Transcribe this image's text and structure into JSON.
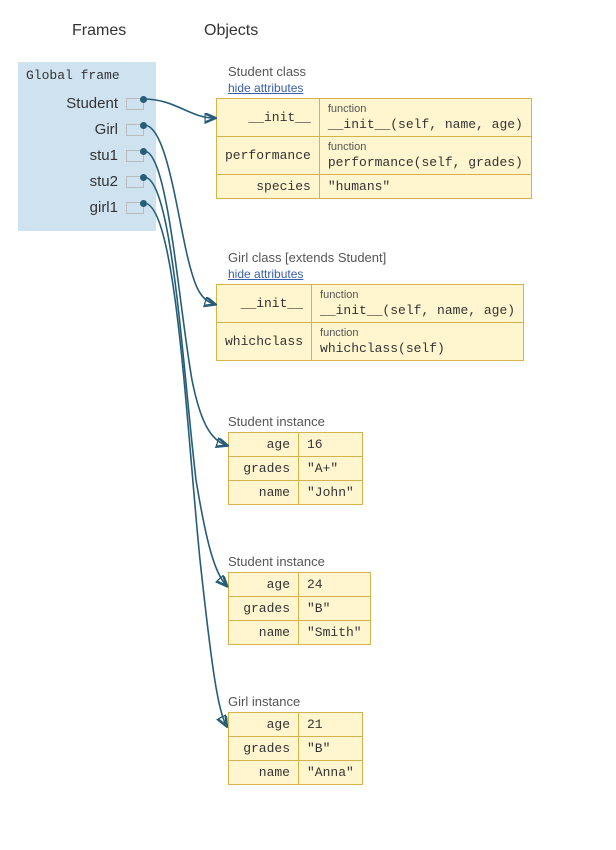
{
  "headers": {
    "frames": "Frames",
    "objects": "Objects"
  },
  "frame": {
    "title": "Global frame",
    "rows": [
      "Student",
      "Girl",
      "stu1",
      "stu2",
      "girl1"
    ]
  },
  "student_class": {
    "title": "Student class",
    "hide": "hide attributes",
    "rows": [
      {
        "key": "__init__",
        "type": "function",
        "sig": "__init__(self, name, age)"
      },
      {
        "key": "performance",
        "type": "function",
        "sig": "performance(self, grades)"
      },
      {
        "key": "species",
        "val": "\"humans\""
      }
    ]
  },
  "girl_class": {
    "title": "Girl class [extends Student]",
    "hide": "hide attributes",
    "rows": [
      {
        "key": "__init__",
        "type": "function",
        "sig": "__init__(self, name, age)"
      },
      {
        "key": "whichclass",
        "type": "function",
        "sig": "whichclass(self)"
      }
    ]
  },
  "inst1": {
    "title": "Student instance",
    "rows": [
      {
        "key": "age",
        "val": "16"
      },
      {
        "key": "grades",
        "val": "\"A+\""
      },
      {
        "key": "name",
        "val": "\"John\""
      }
    ]
  },
  "inst2": {
    "title": "Student instance",
    "rows": [
      {
        "key": "age",
        "val": "24"
      },
      {
        "key": "grades",
        "val": "\"B\""
      },
      {
        "key": "name",
        "val": "\"Smith\""
      }
    ]
  },
  "inst3": {
    "title": "Girl instance",
    "rows": [
      {
        "key": "age",
        "val": "21"
      },
      {
        "key": "grades",
        "val": "\"B\""
      },
      {
        "key": "name",
        "val": "\"Anna\""
      }
    ]
  },
  "colors": {
    "arrow": "#265d78",
    "cell_bg": "#fff6cf",
    "frame_bg": "#cfe2f0"
  }
}
